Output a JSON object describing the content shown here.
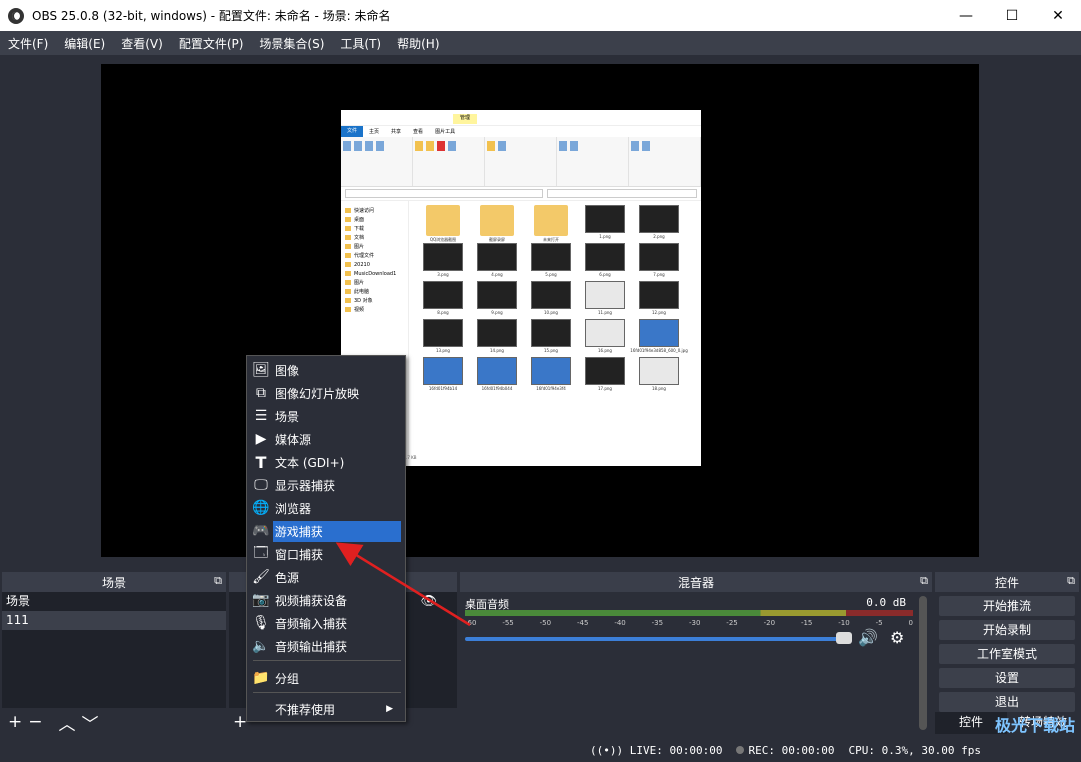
{
  "window": {
    "title": "OBS 25.0.8 (32-bit, windows) - 配置文件: 未命名 - 场景: 未命名",
    "minimize": "—",
    "maximize": "☐",
    "close": "✕"
  },
  "menu": [
    "文件(F)",
    "编辑(E)",
    "查看(V)",
    "配置文件(P)",
    "场景集合(S)",
    "工具(T)",
    "帮助(H)"
  ],
  "explorer": {
    "context_tab": "管理",
    "tabs": [
      "文件",
      "主页",
      "共享",
      "查看",
      "图片工具"
    ],
    "nav_items": [
      "快速访问",
      "桌面",
      "下载",
      "文档",
      "图片",
      "代理文件",
      "20210",
      "MusicDownload1",
      "图片",
      "此电脑",
      "3D 对象",
      "视频"
    ],
    "files": [
      {
        "name": "QQ浏览器截图",
        "kind": "folder"
      },
      {
        "name": "截屏录屏",
        "kind": "folder"
      },
      {
        "name": "未来打开",
        "kind": "folder"
      },
      {
        "name": "1.png",
        "kind": "dark"
      },
      {
        "name": "2.png",
        "kind": "dark"
      },
      {
        "name": "3.png",
        "kind": "dark"
      },
      {
        "name": "4.png",
        "kind": "dark"
      },
      {
        "name": "5.png",
        "kind": "dark"
      },
      {
        "name": "6.png",
        "kind": "dark"
      },
      {
        "name": "7.png",
        "kind": "dark"
      },
      {
        "name": "8.png",
        "kind": "dark"
      },
      {
        "name": "9.png",
        "kind": "dark"
      },
      {
        "name": "10.png",
        "kind": "dark"
      },
      {
        "name": "11.png",
        "kind": "light"
      },
      {
        "name": "12.png",
        "kind": "dark"
      },
      {
        "name": "13.png",
        "kind": "dark"
      },
      {
        "name": "14.png",
        "kind": "dark"
      },
      {
        "name": "15.png",
        "kind": "dark"
      },
      {
        "name": "16.png",
        "kind": "light"
      },
      {
        "name": "16fd01f94e3d858_600_0.jpg",
        "kind": "blue"
      },
      {
        "name": "16fd01f94b14",
        "kind": "blue"
      },
      {
        "name": "16fd01f94b044",
        "kind": "blue"
      },
      {
        "name": "16fd01f94e3f4",
        "kind": "blue"
      },
      {
        "name": "17.png",
        "kind": "dark"
      },
      {
        "name": "18.png",
        "kind": "light"
      }
    ],
    "status": "93.7 KB"
  },
  "scenes": {
    "header": "场景",
    "items": [
      "场景",
      "111"
    ]
  },
  "mixer": {
    "header": "混音器",
    "source_name": "桌面音频",
    "level": "0.0 dB",
    "scale": [
      "-60",
      "-55",
      "-50",
      "-45",
      "-40",
      "-35",
      "-30",
      "-25",
      "-20",
      "-15",
      "-10",
      "-5",
      "0"
    ],
    "volume_fraction": 0.97
  },
  "controls": {
    "header": "控件",
    "buttons": [
      "开始推流",
      "开始录制",
      "工作室模式",
      "设置",
      "退出"
    ],
    "tabs": [
      "控件",
      "转场特效"
    ]
  },
  "status": {
    "live": "LIVE: 00:00:00",
    "rec": "REC: 00:00:00",
    "cpu": "CPU: 0.3%, 30.00 fps"
  },
  "context_menu": {
    "items": [
      {
        "label": "图像",
        "icon": "image-icon"
      },
      {
        "label": "图像幻灯片放映",
        "icon": "slideshow-icon"
      },
      {
        "label": "场景",
        "icon": "scene-list-icon"
      },
      {
        "label": "媒体源",
        "icon": "play-icon"
      },
      {
        "label": "文本 (GDI+)",
        "icon": "text-icon"
      },
      {
        "label": "显示器捕获",
        "icon": "monitor-icon"
      },
      {
        "label": "浏览器",
        "icon": "globe-icon"
      },
      {
        "label": "游戏捕获",
        "icon": "gamepad-icon"
      },
      {
        "label": "窗口捕获",
        "icon": "window-icon"
      },
      {
        "label": "色源",
        "icon": "brush-icon"
      },
      {
        "label": "视频捕获设备",
        "icon": "camera-icon"
      },
      {
        "label": "音频输入捕获",
        "icon": "microphone-icon"
      },
      {
        "label": "音频输出捕获",
        "icon": "speaker-icon"
      },
      {
        "label": "分组",
        "icon": "folder-icon"
      },
      {
        "label": "不推荐使用",
        "icon": "submenu-icon"
      }
    ],
    "highlighted": "游戏捕获",
    "accent": "#2a6fcf"
  },
  "annotation": {
    "arrow_color": "#e02020"
  },
  "watermark": "极光下载站"
}
